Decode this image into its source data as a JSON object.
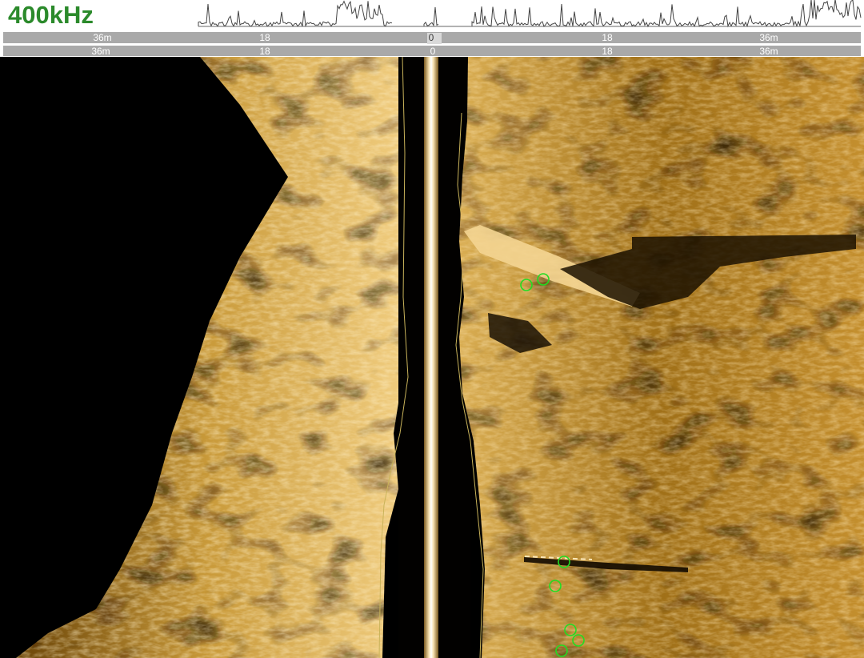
{
  "header": {
    "frequency_label": "400kHz"
  },
  "range_scale_top": {
    "labels": [
      {
        "text": "36m",
        "pos": "left-outer"
      },
      {
        "text": "18",
        "pos": "left-mid"
      },
      {
        "text": "0",
        "pos": "center"
      },
      {
        "text": "18",
        "pos": "right-mid"
      },
      {
        "text": "36m",
        "pos": "right-outer"
      }
    ]
  },
  "range_scale_bottom": {
    "labels": [
      {
        "text": "36m",
        "pos": "left-outer"
      },
      {
        "text": "18",
        "pos": "left-mid"
      },
      {
        "text": "0",
        "pos": "center"
      },
      {
        "text": "18",
        "pos": "right-mid"
      },
      {
        "text": "36m",
        "pos": "right-outer"
      }
    ]
  },
  "colors": {
    "label_green": "#2b8a2b",
    "sonar_bright": "#f2c870",
    "sonar_mid": "#b07a1c",
    "sonar_dark": "#2a1800",
    "marker_green": "#22dd22",
    "scale_track": "#a9a9a9"
  },
  "markers": {
    "count": 7,
    "icon": "green-circle-target-icon"
  }
}
